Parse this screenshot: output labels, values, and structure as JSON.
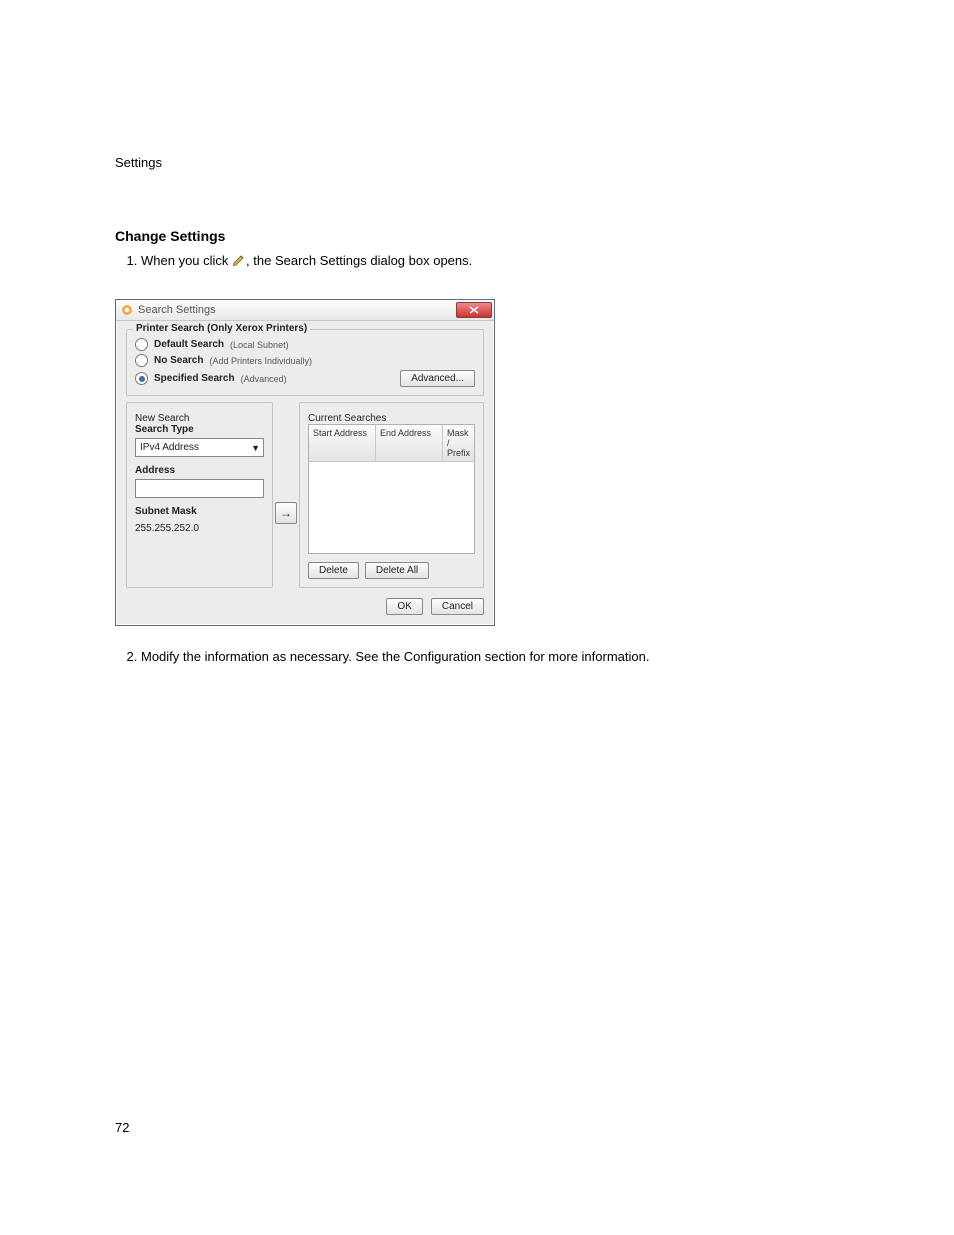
{
  "doc": {
    "section_label": "Settings",
    "heading": "Change Settings",
    "steps": {
      "one_number": "1.",
      "one_part1": "When you click",
      "one_part2": ", the Search Settings dialog box opens.",
      "two_number": "2.",
      "two_text": "Modify the information as necessary. See the Configuration section for more information."
    },
    "page_number": "72"
  },
  "dialog": {
    "title": "Search Settings",
    "groupbox": {
      "legend": "Printer Search (Only Xerox Printers)",
      "opts": {
        "default": {
          "label": "Default Search",
          "hint": "(Local Subnet)"
        },
        "nosearch": {
          "label": "No Search",
          "hint": "(Add Printers Individually)"
        },
        "specified": {
          "label": "Specified Search",
          "hint": "(Advanced)"
        }
      },
      "advanced_btn": "Advanced..."
    },
    "new_search": {
      "legend": "New Search",
      "search_type_label": "Search Type",
      "search_type_value": "IPv4 Address",
      "address_label": "Address",
      "address_value": "",
      "subnet_label": "Subnet Mask",
      "subnet_value": "255.255.252.0"
    },
    "arrow_glyph": "→",
    "current": {
      "legend": "Current Searches",
      "cols": {
        "c1": "Start Address",
        "c2": "End Address",
        "c3": "Mask / Prefix"
      },
      "delete_btn": "Delete",
      "delete_all_btn": "Delete All"
    },
    "footer": {
      "ok": "OK",
      "cancel": "Cancel"
    }
  }
}
